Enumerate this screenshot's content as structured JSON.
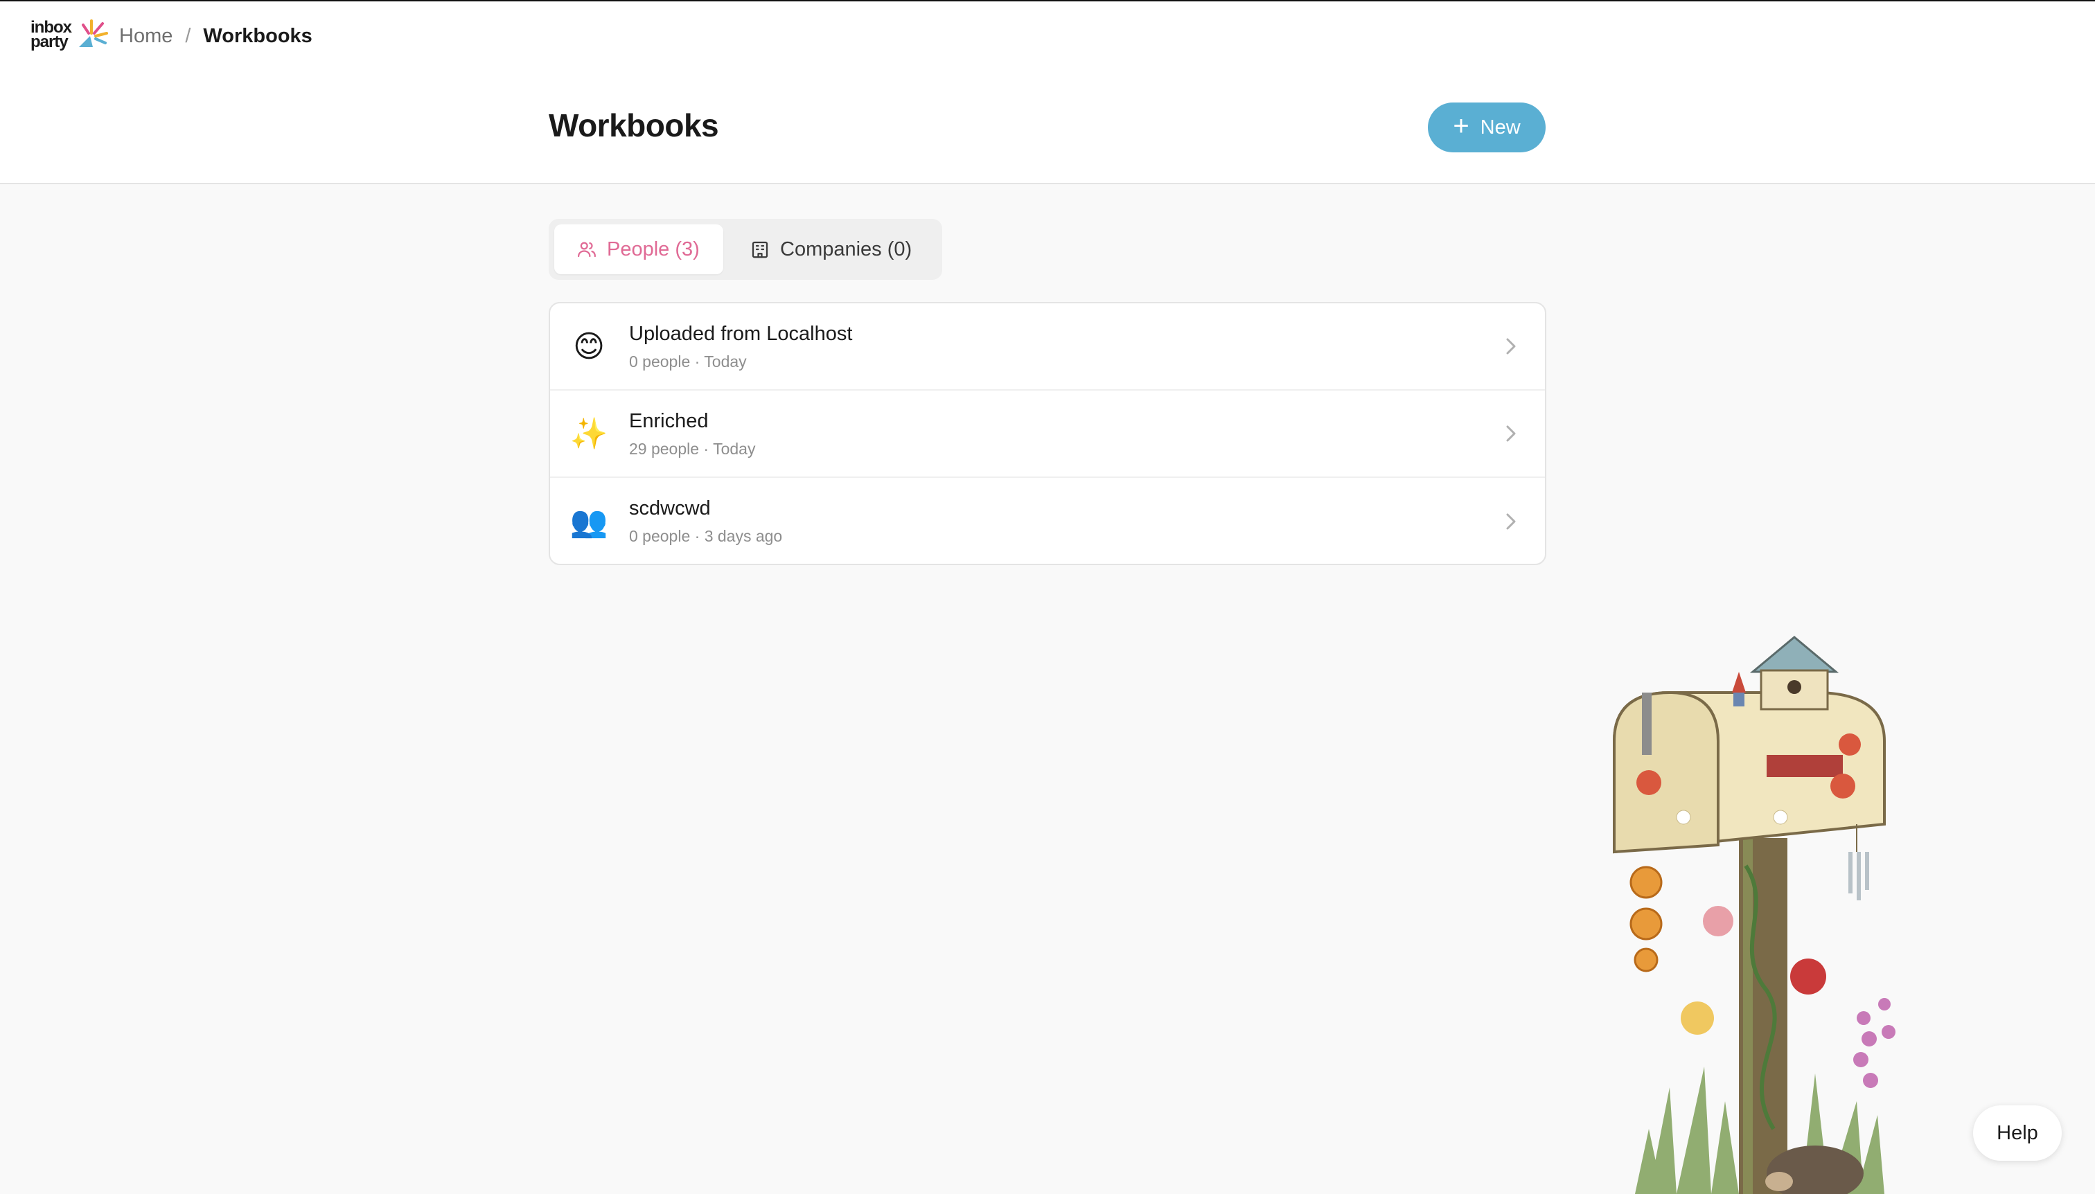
{
  "brand": {
    "logo_line1": "inbox",
    "logo_line2": "party"
  },
  "breadcrumb": {
    "home": "Home",
    "separator": "/",
    "current": "Workbooks"
  },
  "header": {
    "title": "Workbooks",
    "new_button_label": "New"
  },
  "tabs": [
    {
      "label": "People (3)",
      "icon": "people-icon",
      "active": true
    },
    {
      "label": "Companies (0)",
      "icon": "building-icon",
      "active": false
    }
  ],
  "workbooks": [
    {
      "icon": "😊",
      "icon_name": "smiley-emoji-icon",
      "title": "Uploaded from Localhost",
      "meta": "0 people · Today"
    },
    {
      "icon": "✨",
      "icon_name": "sparkles-emoji-icon",
      "title": "Enriched",
      "meta": "29 people · Today"
    },
    {
      "icon": "👥",
      "icon_name": "people-emoji-icon",
      "title": "scdwcwd",
      "meta": "0 people · 3 days ago"
    }
  ],
  "help": {
    "label": "Help"
  },
  "colors": {
    "accent_blue": "#5aafd3",
    "active_tab_pink": "#e06a95"
  }
}
